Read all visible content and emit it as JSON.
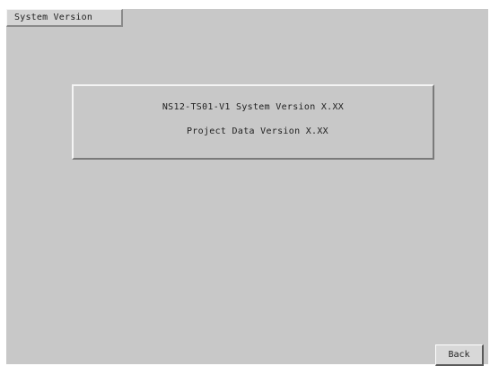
{
  "window": {
    "title": "System Version"
  },
  "info": {
    "system_version_line": "NS12-TS01-V1  System Version X.XX",
    "project_version_line": "Project Data Version X.XX"
  },
  "buttons": {
    "back_label": "Back"
  },
  "colors": {
    "background": "#c8c8c8",
    "text": "#222222"
  }
}
